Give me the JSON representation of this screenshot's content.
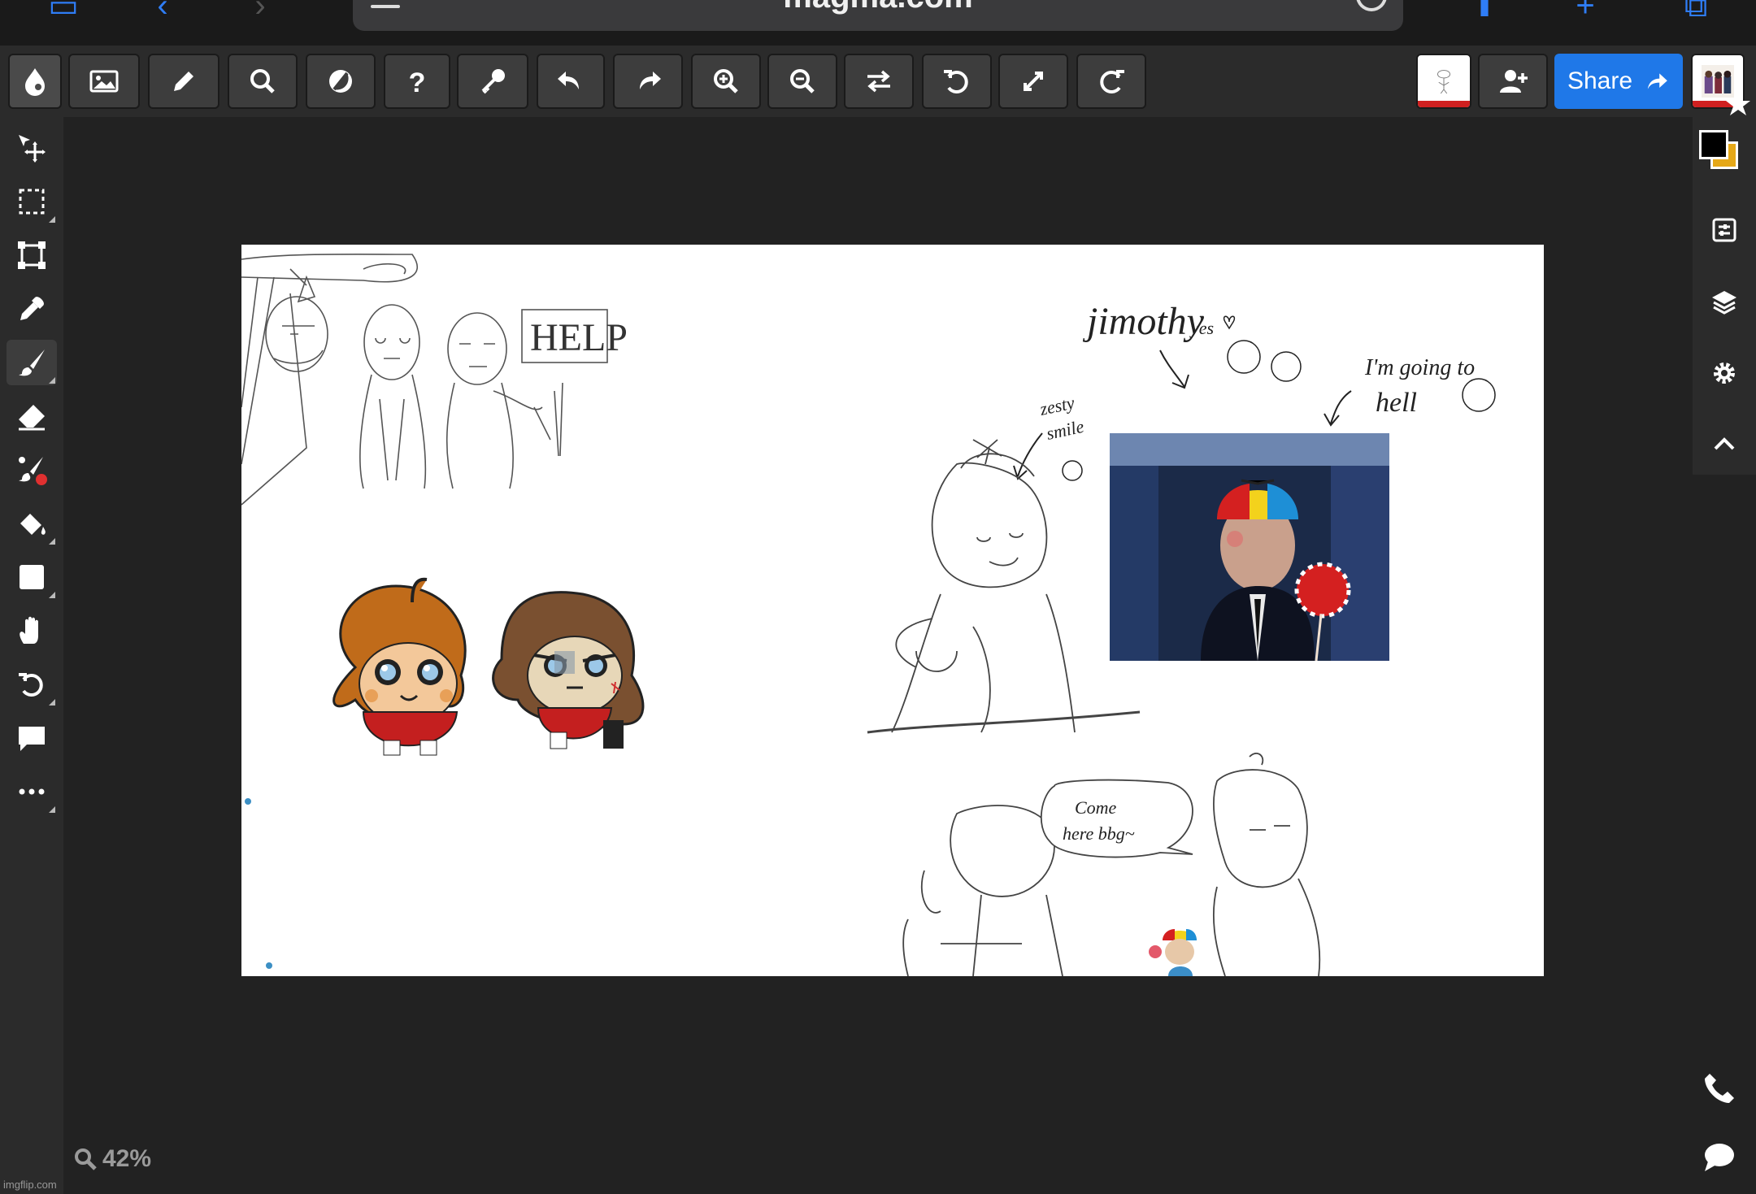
{
  "browser": {
    "url": "magma.com"
  },
  "toolbar": {
    "tools": [
      {
        "name": "magma-logo-icon"
      },
      {
        "name": "image-icon"
      },
      {
        "name": "pencil-icon"
      },
      {
        "name": "search-icon"
      },
      {
        "name": "circle-slash-icon"
      },
      {
        "name": "help-icon"
      },
      {
        "name": "key-icon"
      },
      {
        "name": "undo-icon"
      },
      {
        "name": "redo-icon"
      },
      {
        "name": "zoom-in-icon"
      },
      {
        "name": "zoom-out-icon"
      },
      {
        "name": "flip-icon"
      },
      {
        "name": "rotate-left-icon"
      },
      {
        "name": "fullscreen-icon"
      },
      {
        "name": "rotate-right-icon"
      }
    ],
    "share_label": "Share"
  },
  "left_tools": [
    "move-icon",
    "selection-icon",
    "transform-icon",
    "eyedropper-icon",
    "brush-icon",
    "eraser-icon",
    "smudge-icon",
    "fill-icon",
    "shape-icon",
    "hand-icon",
    "rotate-view-icon",
    "comment-icon",
    "more-icon"
  ],
  "colors": {
    "primary": "#000000",
    "secondary": "#e6a817",
    "accent": "#1f78e8"
  },
  "canvas": {
    "texts": {
      "help": "HELP",
      "jimothy": "jimothy",
      "yes": "yes",
      "zesty": "zesty",
      "smile": "smile",
      "going_to": "I'm going to",
      "hell": "hell",
      "come": "Come",
      "here": "here bbg~"
    }
  },
  "status": {
    "zoom": "42%",
    "watermark": "imgflip.com"
  }
}
